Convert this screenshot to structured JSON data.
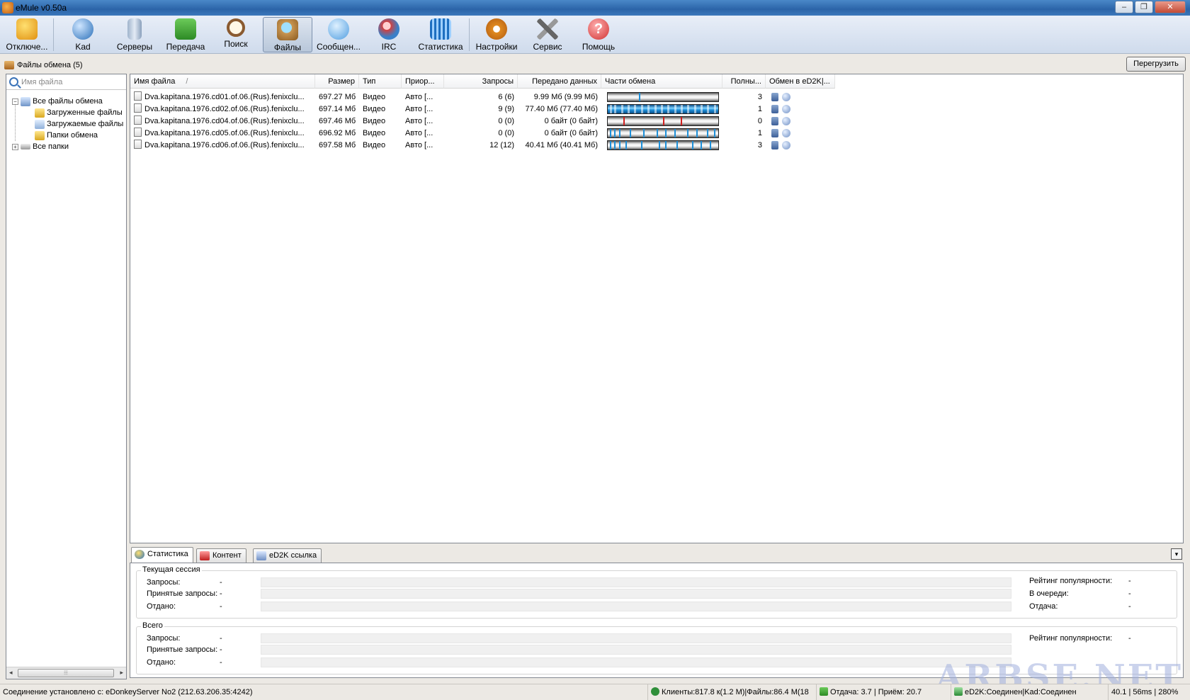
{
  "window": {
    "title": "eMule v0.50a",
    "buttons": [
      "–",
      "❐",
      "✕"
    ]
  },
  "toolbar": {
    "items": [
      {
        "label": "Отключе...",
        "icon": "disconnect-icon",
        "color": "#f0b020"
      },
      {
        "label": "Kad",
        "icon": "kad-globe-icon",
        "color": "#3a7fc8"
      },
      {
        "label": "Серверы",
        "icon": "servers-icon",
        "color": "#8da4c0"
      },
      {
        "label": "Передача",
        "icon": "transfer-folder-icon",
        "color": "#49a33b"
      },
      {
        "label": "Поиск",
        "icon": "search-icon",
        "color": "#b08050"
      },
      {
        "label": "Файлы",
        "icon": "shared-files-icon",
        "color": "#c89550",
        "active": true
      },
      {
        "label": "Сообщен...",
        "icon": "messages-icon",
        "color": "#4f9de0"
      },
      {
        "label": "IRC",
        "icon": "irc-icon",
        "color": "#d04040"
      },
      {
        "label": "Статистика",
        "icon": "statistics-icon",
        "color": "#3a8fd8"
      },
      {
        "label": "Настройки",
        "icon": "settings-gear-icon",
        "color": "#e08a20"
      },
      {
        "label": "Сервис",
        "icon": "tools-icon",
        "color": "#777777"
      },
      {
        "label": "Помощь",
        "icon": "help-icon",
        "color": "#d03030"
      }
    ]
  },
  "header": {
    "title": "Файлы обмена (5)",
    "reload_label": "Перегрузить"
  },
  "left_panel": {
    "search_placeholder": "Имя файла",
    "tree": [
      {
        "label": "Все файлы обмена",
        "icon": "all-shared-icon",
        "expander": "−"
      },
      {
        "label": "Загруженные файлы",
        "icon": "downloaded-folder-icon"
      },
      {
        "label": "Загружаемые файлы",
        "icon": "downloading-folder-icon"
      },
      {
        "label": "Папки обмена",
        "icon": "shared-folder-icon"
      },
      {
        "label": "Все папки",
        "icon": "all-folders-icon",
        "expander": "+"
      }
    ],
    "scroll_thumb": "⦙⦙⦙"
  },
  "file_list": {
    "columns": [
      "Имя файла",
      "Размер",
      "Тип",
      "Приор...",
      "Запросы",
      "Передано данных",
      "Части обмена",
      "Полны...",
      "Обмен в eD2K|..."
    ],
    "sort_indicator": "/",
    "rows": [
      {
        "name": "Dva.kapitana.1976.cd01.of.06.(Rus).fenixclu...",
        "size": "697.27 Мб",
        "type": "Видео",
        "priority": "Авто [...",
        "requests": "6 (6)",
        "transferred": "9.99 Мб (9.99 Мб)",
        "complete": "3",
        "parts": [
          0.28
        ],
        "part_color": "#1e8fd8"
      },
      {
        "name": "Dva.kapitana.1976.cd02.of.06.(Rus).fenixclu...",
        "size": "697.14 Мб",
        "type": "Видео",
        "priority": "Авто [...",
        "requests": "9 (9)",
        "transferred": "77.40 Мб (77.40 Мб)",
        "complete": "1",
        "parts": [
          0.02,
          0.06,
          0.12,
          0.18,
          0.24,
          0.3,
          0.36,
          0.42,
          0.48,
          0.54,
          0.6,
          0.66,
          0.72,
          0.78,
          0.84,
          0.9,
          0.96
        ],
        "part_color": "#1e8fd8",
        "full": true
      },
      {
        "name": "Dva.kapitana.1976.cd04.of.06.(Rus).fenixclu...",
        "size": "697.46 Мб",
        "type": "Видео",
        "priority": "Авто [...",
        "requests": "0 (0)",
        "transferred": "0 байт (0 байт)",
        "complete": "0",
        "parts": [
          0.14,
          0.5,
          0.66
        ],
        "part_color": "#d02020"
      },
      {
        "name": "Dva.kapitana.1976.cd05.of.06.(Rus).fenixclu...",
        "size": "696.92 Мб",
        "type": "Видео",
        "priority": "Авто [...",
        "requests": "0 (0)",
        "transferred": "0 байт (0 байт)",
        "complete": "1",
        "parts": [
          0.02,
          0.06,
          0.1,
          0.2,
          0.32,
          0.44,
          0.52,
          0.6,
          0.72,
          0.8,
          0.9,
          0.96
        ],
        "part_color": "#1e8fd8"
      },
      {
        "name": "Dva.kapitana.1976.cd06.of.06.(Rus).fenixclu...",
        "size": "697.58 Мб",
        "type": "Видео",
        "priority": "Авто [...",
        "requests": "12 (12)",
        "transferred": "40.41 Мб (40.41 Мб)",
        "complete": "3",
        "parts": [
          0.02,
          0.06,
          0.1,
          0.16,
          0.3,
          0.46,
          0.52,
          0.62,
          0.76,
          0.84,
          0.92
        ],
        "part_color": "#1e8fd8"
      }
    ]
  },
  "details": {
    "tabs": [
      {
        "label": "Статистика",
        "icon": "statistics-tab-icon",
        "active": true
      },
      {
        "label": "Контент",
        "icon": "content-tab-icon"
      },
      {
        "label": "eD2K ссылка",
        "icon": "ed2k-link-icon"
      }
    ],
    "collapse": "▾",
    "session": {
      "title": "Текущая сессия",
      "rows": [
        {
          "label": "Запросы:",
          "value": "-"
        },
        {
          "label": "Принятые запросы:",
          "value": "-"
        },
        {
          "label": "Отдано:",
          "value": "-"
        }
      ],
      "right": [
        {
          "label": "Рейтинг популярности:",
          "value": "-"
        },
        {
          "label": "В очереди:",
          "value": "-"
        },
        {
          "label": "Отдача:",
          "value": "-"
        }
      ]
    },
    "total": {
      "title": "Всего",
      "rows": [
        {
          "label": "Запросы:",
          "value": "-"
        },
        {
          "label": "Принятые запросы:",
          "value": "-"
        },
        {
          "label": "Отдано:",
          "value": "-"
        }
      ],
      "right": [
        {
          "label": "Рейтинг популярности:",
          "value": "-"
        }
      ]
    }
  },
  "statusbar": {
    "connection": "Соединение установлено с: eDonkeyServer No2 (212.63.206.35:4242)",
    "clients": "Клиенты:817.8 к(1.2 М)|Файлы:86.4 М(18",
    "rates": "Отдача: 3.7 | Приём: 20.7",
    "network": "eD2K:Соединен|Kad:Соединен",
    "misc": "40.1 | 56ms | 280%"
  },
  "watermark": "ARBSE.NET"
}
